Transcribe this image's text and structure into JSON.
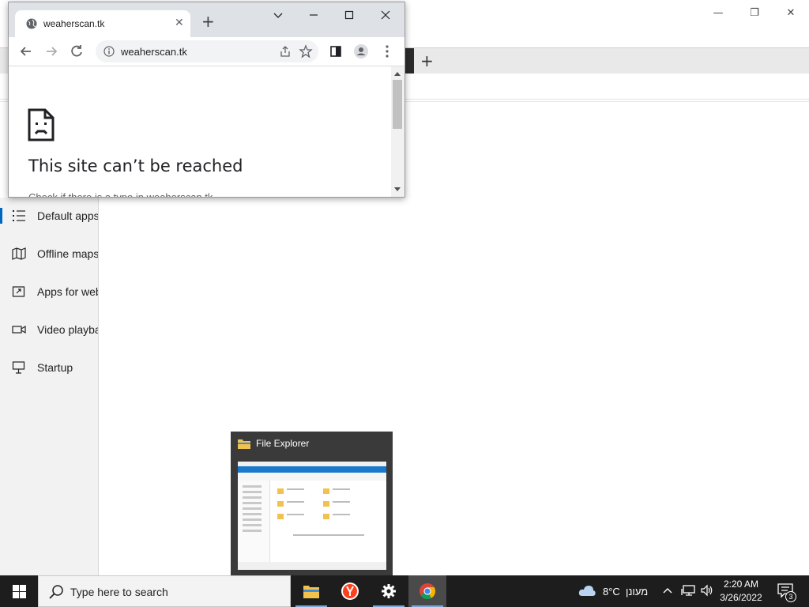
{
  "chrome": {
    "tab_title": "weaherscan.tk",
    "url": "weaherscan.tk",
    "error_title": "This site can’t be reached",
    "error_sub": "Check if there is a typo in weaherscan.tk."
  },
  "settings_nav": {
    "items": [
      {
        "label": "Default apps",
        "icon": "default-apps-icon",
        "selected": true
      },
      {
        "label": "Offline maps",
        "icon": "map-icon"
      },
      {
        "label": "Apps for websites",
        "icon": "link-window-icon"
      },
      {
        "label": "Video playback",
        "icon": "video-icon"
      },
      {
        "label": "Startup",
        "icon": "startup-icon"
      }
    ]
  },
  "thumbnail": {
    "title": "File Explorer"
  },
  "taskbar": {
    "search_placeholder": "Type here to search",
    "weather_temp": "8°C",
    "weather_desc": "מעונן",
    "time": "2:20 AM",
    "date": "3/26/2022",
    "notification_count": "3"
  },
  "colors": {
    "accent": "#0067c0",
    "taskbar": "#1d1d1d",
    "chrome_frame": "#dee1e6"
  }
}
